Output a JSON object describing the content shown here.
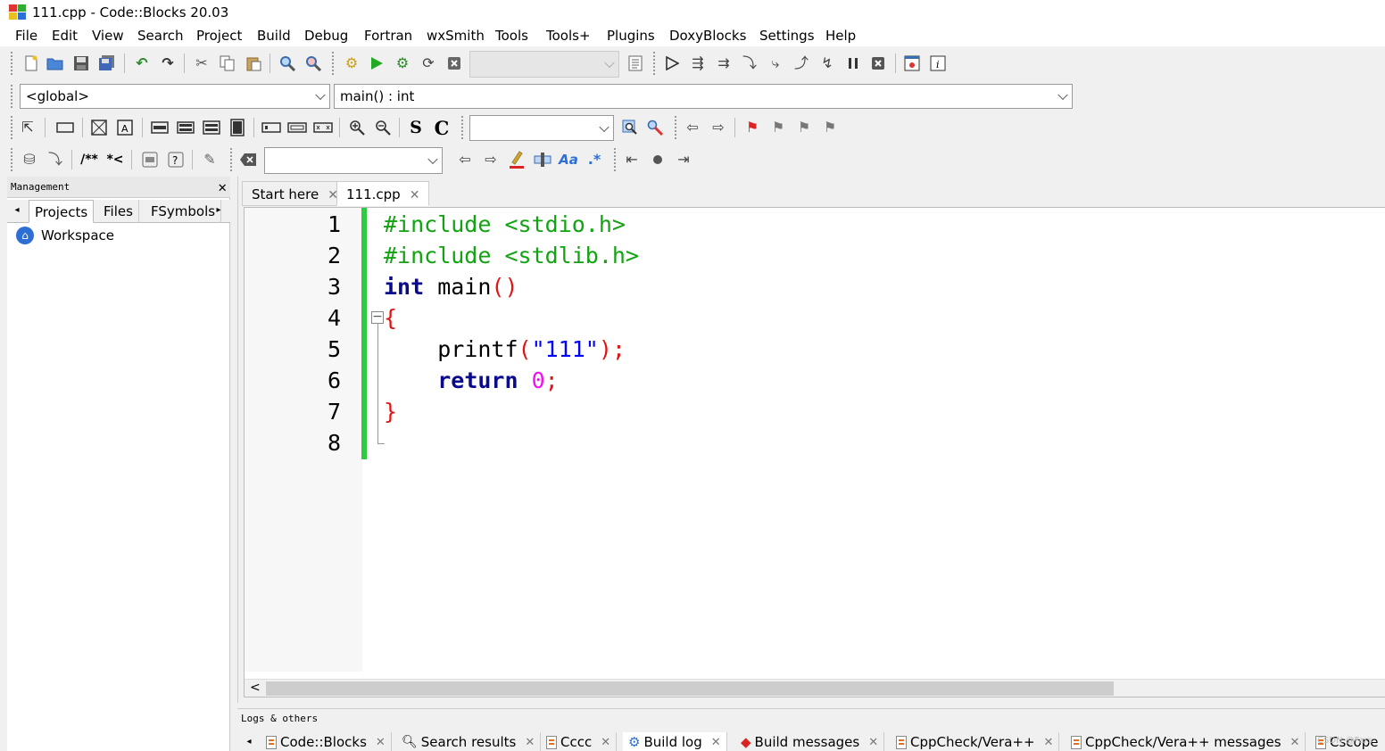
{
  "window": {
    "title": "111.cpp - Code::Blocks 20.03"
  },
  "menu": [
    "File",
    "Edit",
    "View",
    "Search",
    "Project",
    "Build",
    "Debug",
    "Fortran",
    "wxSmith",
    "Tools",
    "Tools+",
    "Plugins",
    "DoxyBlocks",
    "Settings",
    "Help"
  ],
  "code_completion": {
    "scope": "<global>",
    "function": "main() : int"
  },
  "management": {
    "header": "Management",
    "tabs": [
      "Projects",
      "Files",
      "FSymbols"
    ],
    "active_tab": "Projects",
    "tree_root": "Workspace"
  },
  "editor": {
    "tabs": [
      {
        "label": "Start here",
        "active": false
      },
      {
        "label": "111.cpp",
        "active": true
      }
    ],
    "line_numbers": [
      "1",
      "2",
      "3",
      "4",
      "5",
      "6",
      "7",
      "8"
    ],
    "code": [
      [
        {
          "t": "#include <stdio.h>",
          "c": "pp"
        }
      ],
      [
        {
          "t": "#include <stdlib.h>",
          "c": "pp"
        }
      ],
      [
        {
          "t": "int",
          "c": "kw"
        },
        {
          "t": " main",
          "c": "plain"
        },
        {
          "t": "()",
          "c": "op"
        }
      ],
      [
        {
          "t": "{",
          "c": "op"
        }
      ],
      [
        {
          "t": "    printf",
          "c": "plain"
        },
        {
          "t": "(",
          "c": "op"
        },
        {
          "t": "\"111\"",
          "c": "str"
        },
        {
          "t": ");",
          "c": "op"
        }
      ],
      [
        {
          "t": "    ",
          "c": "plain"
        },
        {
          "t": "return",
          "c": "kw"
        },
        {
          "t": " ",
          "c": "plain"
        },
        {
          "t": "0",
          "c": "num"
        },
        {
          "t": ";",
          "c": "op"
        }
      ],
      [
        {
          "t": "}",
          "c": "op"
        }
      ],
      []
    ]
  },
  "logs": {
    "header": "Logs & others",
    "tabs": [
      {
        "label": "Code::Blocks",
        "icon": "document-icon"
      },
      {
        "label": "Search results",
        "icon": "search-icon"
      },
      {
        "label": "Cccc",
        "icon": "document-icon"
      },
      {
        "label": "Build log",
        "icon": "gear-icon",
        "active": true
      },
      {
        "label": "Build messages",
        "icon": "diamond-icon"
      },
      {
        "label": "CppCheck/Vera++",
        "icon": "document-icon"
      },
      {
        "label": "CppCheck/Vera++ messages",
        "icon": "document-icon"
      },
      {
        "label": "Cscope",
        "icon": "document-icon"
      }
    ]
  },
  "watermark": "CSDN @Fars"
}
